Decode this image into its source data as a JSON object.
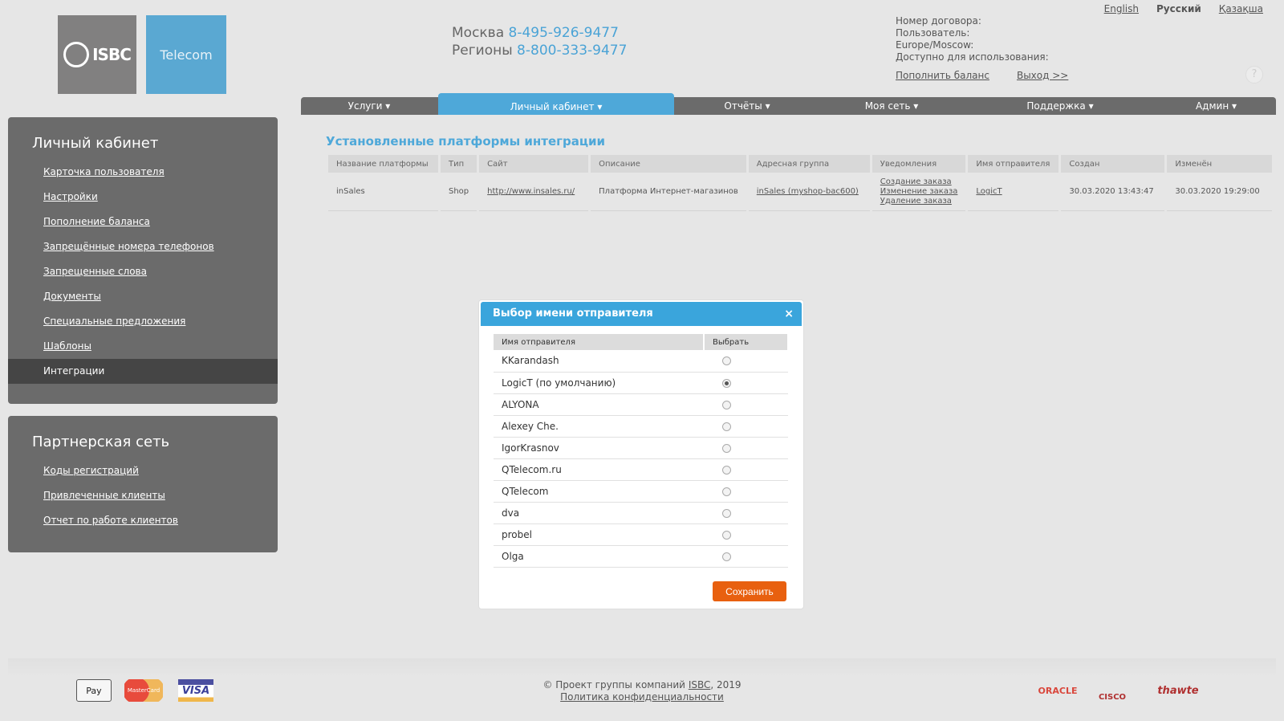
{
  "logo": {
    "brand": "ISBC",
    "telecom": "Telecom"
  },
  "contacts": {
    "moscow_label": "Москва",
    "moscow_phone": "8-495-926-9477",
    "regions_label": "Регионы",
    "regions_phone": "8-800-333-9477"
  },
  "langs": [
    "English",
    "Русский",
    "Қазақша"
  ],
  "account": {
    "lines": [
      "Номер договора:",
      "Пользователь:",
      "Europe/Moscow:",
      "Доступно для использования:"
    ],
    "topup": "Пополнить баланс",
    "logout": "Выход >>",
    "help": "?"
  },
  "nav": [
    "Услуги",
    "Личный кабинет",
    "Отчёты",
    "Моя сеть",
    "Поддержка",
    "Админ"
  ],
  "sidebar1": {
    "title": "Личный кабинет",
    "items": [
      "Карточка пользователя",
      "Настройки",
      "Пополнение баланса",
      "Запрещённые номера телефонов",
      "Запрещенные слова",
      "Документы",
      "Специальные предложения",
      "Шаблоны",
      "Интеграции"
    ]
  },
  "sidebar2": {
    "title": "Партнерская сеть",
    "items": [
      "Коды регистраций",
      "Привлеченные клиенты",
      "Отчет по работе клиентов"
    ]
  },
  "main": {
    "title": "Установленные платформы интеграции",
    "columns": [
      "Название платформы",
      "Тип",
      "Сайт",
      "Описание",
      "Адресная группа",
      "Уведомления",
      "Имя отправителя",
      "Создан",
      "Изменён"
    ],
    "row": {
      "name": "inSales",
      "type": "Shop",
      "site": "http://www.insales.ru/",
      "desc": "Платформа Интернет-магазинов",
      "group": "inSales (myshop-bac600)",
      "notif": [
        "Создание заказа",
        "Изменение заказа",
        "Удаление заказа"
      ],
      "sender": "LogicT",
      "created": "30.03.2020 13:43:47",
      "modified": "30.03.2020 19:29:00"
    }
  },
  "modal": {
    "title": "Выбор имени отправителя",
    "close": "×",
    "col_name": "Имя отправителя",
    "col_select": "Выбрать",
    "senders": [
      "KKarandash",
      "LogicT (по умолчанию)",
      "ALYONA",
      "Alexey Che.",
      "IgorKrasnov",
      "QTelecom.ru",
      "QTelecom",
      "dva",
      "probel",
      "Olga"
    ],
    "selected_index": 1,
    "save": "Сохранить"
  },
  "footer": {
    "copyright": "© Проект группы компаний",
    "isbc": "ISBC",
    "year": ", 2019",
    "privacy": "Политика конфиденциальности",
    "pay": [
      "Pay",
      "MasterCard",
      "VISA"
    ],
    "partners": [
      "ORACLE",
      "CISCO",
      "thawte"
    ]
  }
}
